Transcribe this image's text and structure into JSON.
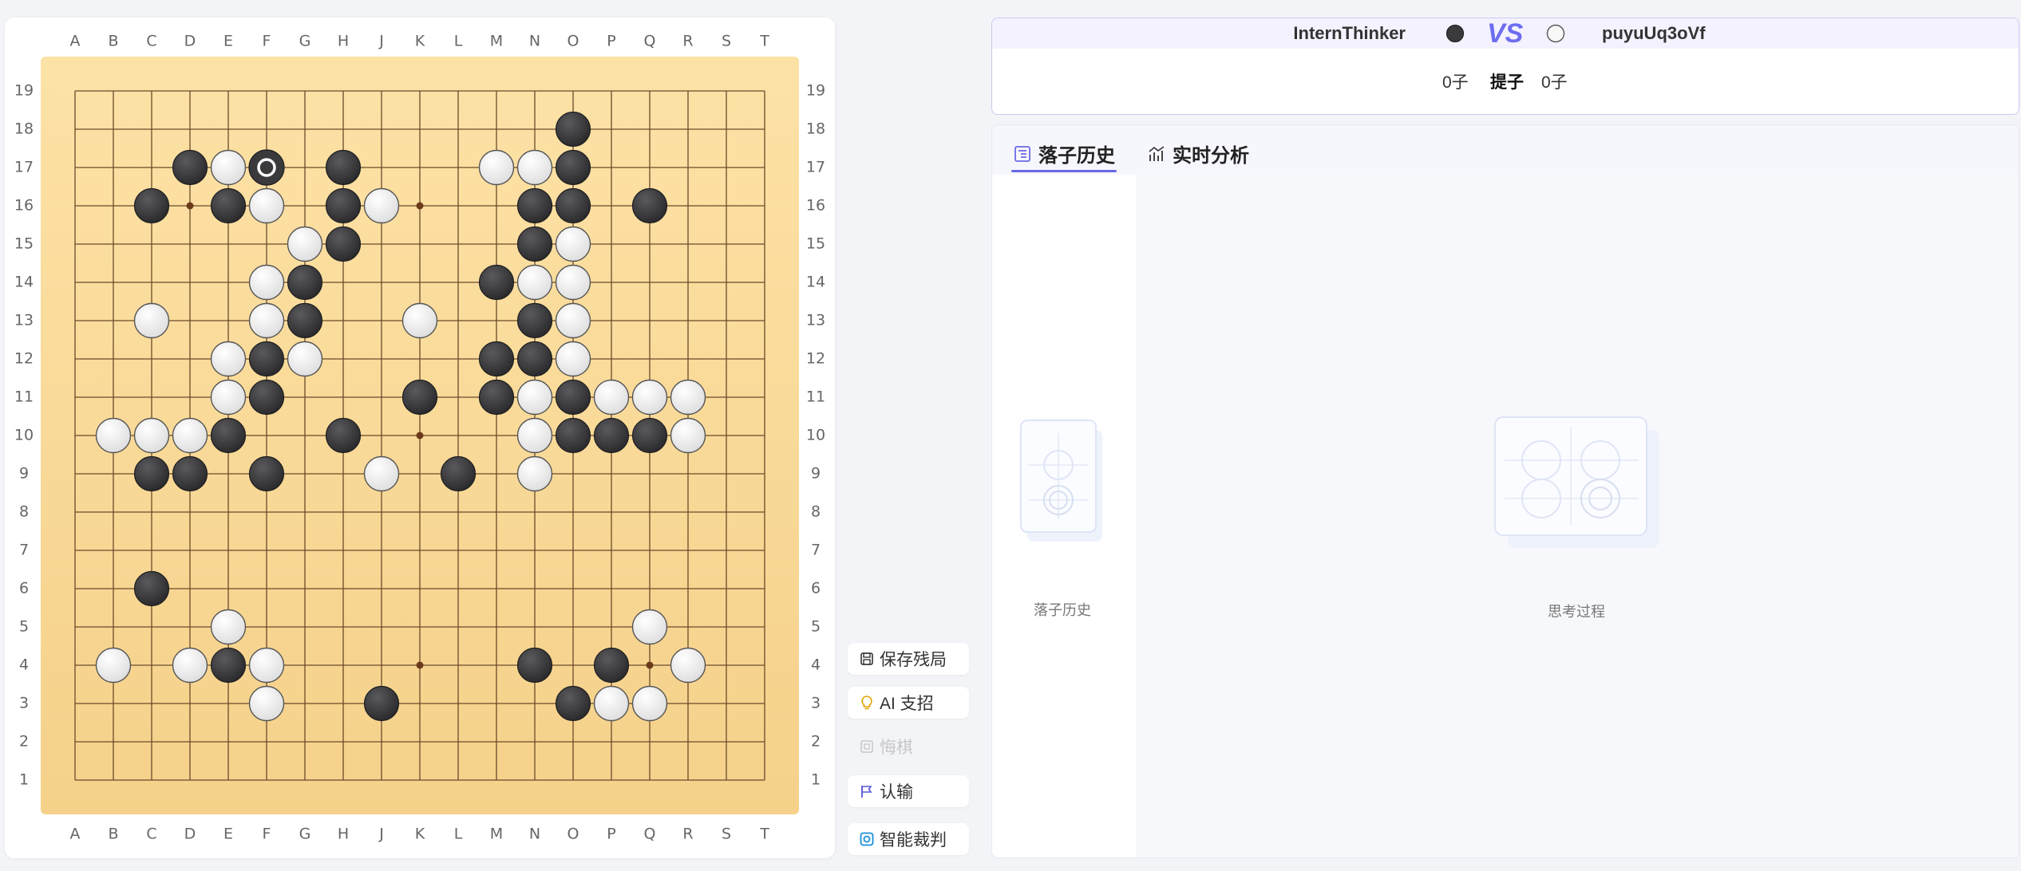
{
  "board": {
    "columns": [
      "A",
      "B",
      "C",
      "D",
      "E",
      "F",
      "G",
      "H",
      "J",
      "K",
      "L",
      "M",
      "N",
      "O",
      "P",
      "Q",
      "R",
      "S",
      "T"
    ],
    "rows": [
      "19",
      "18",
      "17",
      "16",
      "15",
      "14",
      "13",
      "12",
      "11",
      "10",
      "9",
      "8",
      "7",
      "6",
      "5",
      "4",
      "3",
      "2",
      "1"
    ],
    "star_points": [
      "D16",
      "K16",
      "Q16",
      "D10",
      "K10",
      "Q10",
      "D4",
      "K4",
      "Q4"
    ],
    "last_move": "F17",
    "black_stones": [
      "O18",
      "D17",
      "H17",
      "O17",
      "C16",
      "E16",
      "H16",
      "N16",
      "O16",
      "Q16",
      "H15",
      "N15",
      "G14",
      "M14",
      "G13",
      "N13",
      "F12",
      "M12",
      "N12",
      "F11",
      "K11",
      "M11",
      "O11",
      "E10",
      "H10",
      "O10",
      "P10",
      "Q10",
      "C9",
      "D9",
      "F9",
      "L9",
      "C6",
      "E4",
      "N4",
      "P4",
      "J3",
      "O3"
    ],
    "white_stones": [
      "E17",
      "F17",
      "M17",
      "N17",
      "F16",
      "J16",
      "G15",
      "O15",
      "F14",
      "N14",
      "O14",
      "C13",
      "F13",
      "K13",
      "O13",
      "E12",
      "G12",
      "O12",
      "E11",
      "N11",
      "P11",
      "Q11",
      "R11",
      "B10",
      "C10",
      "D10",
      "N10",
      "R10",
      "J9",
      "N9",
      "E5",
      "Q5",
      "B4",
      "D4",
      "F4",
      "R4",
      "F3",
      "P3",
      "Q3"
    ]
  },
  "controls": {
    "save": "保存残局",
    "ai_hint": "AI 支招",
    "undo": "悔棋",
    "resign": "认输",
    "judge": "智能裁判"
  },
  "players": {
    "black_name": "InternThinker",
    "white_name": "puyuUq3oVf",
    "vs": "VS",
    "black_captures": "0子",
    "captures_label": "提子",
    "white_captures": "0子"
  },
  "tabs": {
    "history": "落子历史",
    "analysis": "实时分析"
  },
  "empty": {
    "history": "落子历史",
    "thinking": "思考过程"
  },
  "colors": {
    "board_top": "#fde2a6",
    "board_bottom": "#f5d18a",
    "accent": "#6a6ae6",
    "black_stone": "#3a3a3c",
    "white_stone": "#f7f7f7"
  }
}
